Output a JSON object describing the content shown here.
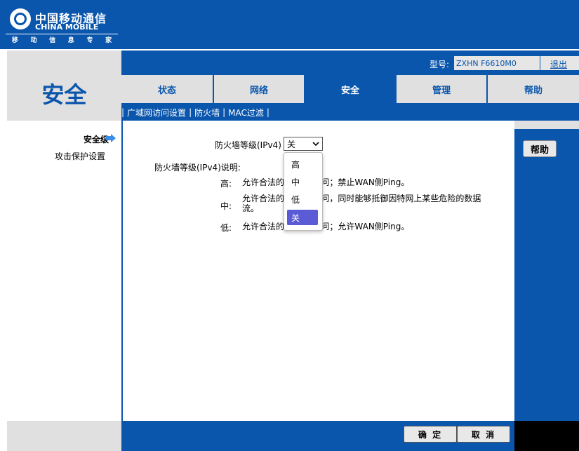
{
  "logo": {
    "cn": "中国移动通信",
    "en": "CHINA MOBILE",
    "sub": [
      "移",
      "动",
      "信",
      "息",
      "专",
      "家"
    ]
  },
  "header": {
    "model_label": "型号:",
    "model_value": "ZXHN F6610M0",
    "logout": "退出"
  },
  "section_title": "安全",
  "tabs": [
    {
      "label": "状态",
      "active": false
    },
    {
      "label": "网络",
      "active": false
    },
    {
      "label": "安全",
      "active": true
    },
    {
      "label": "管理",
      "active": false
    },
    {
      "label": "帮助",
      "active": false
    }
  ],
  "subnav": [
    "广域网访问设置",
    "防火墙",
    "MAC过滤"
  ],
  "sidebar": {
    "items": [
      {
        "label": "安全级",
        "active": true
      },
      {
        "label": "攻击保护设置",
        "active": false
      }
    ]
  },
  "form": {
    "level_label": "防火墙等级(IPv4)",
    "level_value": "关",
    "options": [
      "高",
      "中",
      "低",
      "关"
    ],
    "desc_title": "防火墙等级(IPv4)说明:",
    "rows": [
      {
        "label": "高:",
        "text": "允许合法的WAN侧访问；禁止WAN侧Ping。"
      },
      {
        "label": "中:",
        "text": "允许合法的WAN侧访问，同时能够抵御因特网上某些危险的数据流。"
      },
      {
        "label": "低:",
        "text": "允许合法的WAN侧访问；允许WAN侧Ping。"
      }
    ]
  },
  "help_button": "帮助",
  "footer": {
    "ok": "确 定",
    "cancel": "取 消"
  },
  "colors": {
    "brand_blue": "#0a56ad",
    "panel_gray": "#e0e0e0",
    "selected_option": "#5b5bd6"
  }
}
